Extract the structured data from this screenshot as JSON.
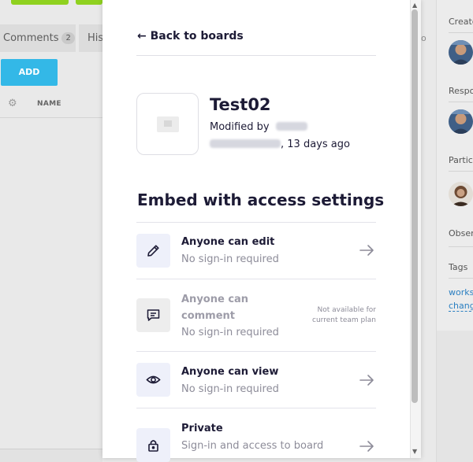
{
  "background": {
    "tabs": [
      {
        "label": "Comments",
        "count": "2"
      },
      {
        "label": "His"
      }
    ],
    "add_label": "ADD",
    "name_column": "NAME",
    "o_fragment": "o",
    "right_panel": {
      "created_label": "Create",
      "responsible_label": "Respo",
      "participants_label": "Partic",
      "observers_label": "Obser",
      "tags_label": "Tags",
      "tag_link_1": "works",
      "tag_link_2": "chang"
    }
  },
  "modal": {
    "back_label": "← Back to boards",
    "board": {
      "title": "Test02",
      "modified_prefix": "Modified by",
      "modified_suffix": ", 13 days ago"
    },
    "embed_title": "Embed with access settings",
    "options": [
      {
        "name": "Anyone can edit",
        "sub": "No sign-in required",
        "icon": "pencil-icon",
        "available": true
      },
      {
        "name_line1": "Anyone can",
        "name_line2": "comment",
        "sub": "No sign-in required",
        "icon": "comment-icon",
        "available": false,
        "note_line1": "Not available for",
        "note_line2": "current team plan"
      },
      {
        "name": "Anyone can view",
        "sub": "No sign-in required",
        "icon": "eye-icon",
        "available": true
      },
      {
        "name": "Private",
        "sub": "Sign-in and access to board",
        "icon": "lock-icon",
        "available": true
      }
    ]
  },
  "colors": {
    "accent_green": "#8fd11f",
    "add_button": "#33b8e7",
    "text_dark": "#1d1b36",
    "icon_bg": "#eef0fa"
  }
}
